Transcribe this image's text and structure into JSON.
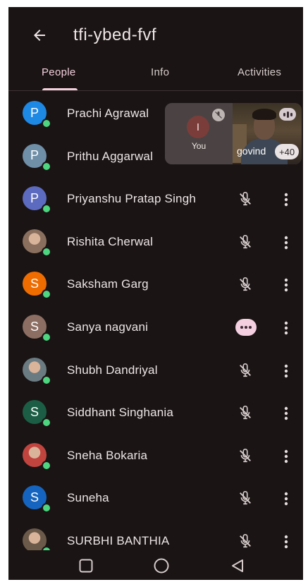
{
  "header": {
    "title": "tfi-ybed-fvf"
  },
  "tabs": [
    {
      "label": "People",
      "active": true
    },
    {
      "label": "Info",
      "active": false
    },
    {
      "label": "Activities",
      "active": false
    }
  ],
  "participants": [
    {
      "name": "Prachi Agrawal",
      "initial": "P",
      "avatar_color": "#1e88e5",
      "status": "muted"
    },
    {
      "name": "Prithu Aggarwal",
      "initial": "P",
      "avatar_color": "#6f8fa8",
      "status": "muted"
    },
    {
      "name": "Priyanshu Pratap Singh",
      "initial": "P",
      "avatar_color": "#5c6bc0",
      "status": "muted"
    },
    {
      "name": "Rishita Cherwal",
      "initial": "",
      "avatar_color": "#8a6f5e",
      "status": "muted",
      "photo": true
    },
    {
      "name": "Saksham Garg",
      "initial": "S",
      "avatar_color": "#ef6c00",
      "status": "muted"
    },
    {
      "name": "Sanya nagvani",
      "initial": "S",
      "avatar_color": "#8d6e63",
      "status": "more"
    },
    {
      "name": "Shubh Dandriyal",
      "initial": "",
      "avatar_color": "#6b7b82",
      "status": "muted",
      "photo": true
    },
    {
      "name": "Siddhant Singhania",
      "initial": "S",
      "avatar_color": "#1b5e45",
      "status": "muted"
    },
    {
      "name": "Sneha Bokaria",
      "initial": "",
      "avatar_color": "#c2443f",
      "status": "muted",
      "photo": true
    },
    {
      "name": "Suneha",
      "initial": "S",
      "avatar_color": "#1565c0",
      "status": "muted"
    },
    {
      "name": "SURBHI BANTHIA",
      "initial": "",
      "avatar_color": "#6b5a4a",
      "status": "muted",
      "photo": true
    }
  ],
  "call_tile": {
    "self_initial": "I",
    "self_label": "You",
    "video_name": "govind",
    "overflow_count": "+40"
  },
  "icons": {
    "back": "arrow-left-icon",
    "muted": "mic-off-icon",
    "more": "more-horizontal-icon",
    "kebab": "more-vertical-icon",
    "nav": [
      "square-icon",
      "circle-icon",
      "triangle-back-icon"
    ]
  },
  "colors": {
    "background": "#1a1414",
    "accent": "#f3cfdc",
    "presence": "#4dd580"
  }
}
